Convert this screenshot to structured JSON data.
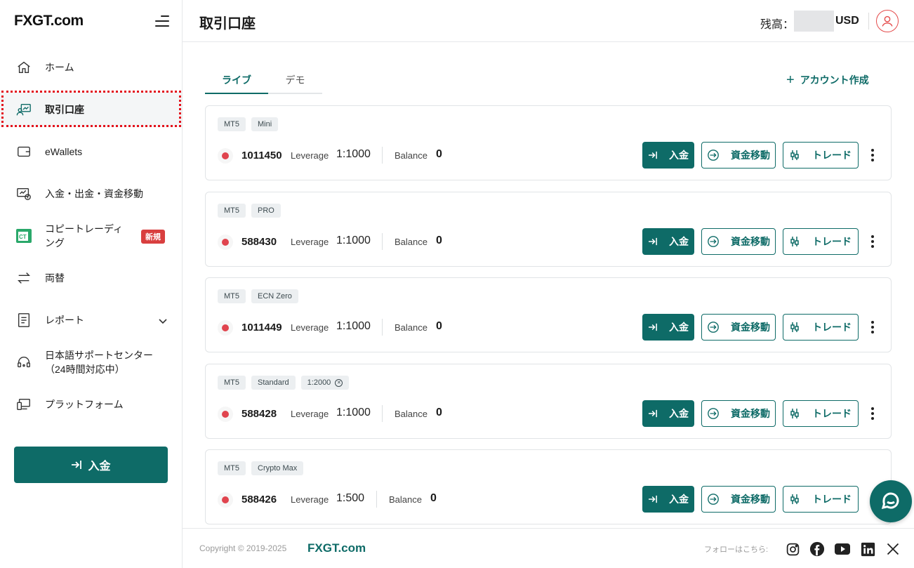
{
  "brand": {
    "logo_main": "FXGT",
    "logo_suffix": ".com"
  },
  "sidebar": {
    "items": [
      {
        "label": "ホーム",
        "icon": "home-icon"
      },
      {
        "label": "取引口座",
        "icon": "trading-accounts-icon",
        "active": true
      },
      {
        "label": "eWallets",
        "icon": "wallet-icon"
      },
      {
        "label": "入金・出金・資金移動",
        "icon": "deposit-withdraw-icon"
      },
      {
        "label": "コピートレーディング",
        "icon": "copy-trading-icon",
        "badge": "新規"
      },
      {
        "label": "両替",
        "icon": "exchange-icon"
      },
      {
        "label": "レポート",
        "icon": "report-icon"
      },
      {
        "label": "日本語サポートセンター（24時間対応中）",
        "icon": "support-headset-icon"
      },
      {
        "label": "プラットフォーム",
        "icon": "platform-icon"
      }
    ],
    "deposit_button": "入金"
  },
  "header": {
    "title": "取引口座",
    "balance_label": "残高：",
    "currency": "USD"
  },
  "tabs": [
    {
      "label": "ライブ",
      "active": true
    },
    {
      "label": "デモ",
      "active": false
    }
  ],
  "add_account_label": "アカウント作成",
  "accounts": [
    {
      "tags": [
        "MT5",
        "Mini"
      ],
      "number": "1011450",
      "leverage_label": "Leverage",
      "leverage": "1:1000",
      "balance_label": "Balance",
      "balance": "0"
    },
    {
      "tags": [
        "MT5",
        "PRO"
      ],
      "number": "588430",
      "leverage_label": "Leverage",
      "leverage": "1:1000",
      "balance_label": "Balance",
      "balance": "0"
    },
    {
      "tags": [
        "MT5",
        "ECN Zero"
      ],
      "number": "1011449",
      "leverage_label": "Leverage",
      "leverage": "1:1000",
      "balance_label": "Balance",
      "balance": "0"
    },
    {
      "tags": [
        "MT5",
        "Standard",
        "1:2000"
      ],
      "number": "588428",
      "leverage_label": "Leverage",
      "leverage": "1:1000",
      "balance_label": "Balance",
      "balance": "0"
    },
    {
      "tags": [
        "MT5",
        "Crypto Max"
      ],
      "number": "588426",
      "leverage_label": "Leverage",
      "leverage": "1:500",
      "balance_label": "Balance",
      "balance": "0"
    }
  ],
  "account_actions": {
    "deposit": "入金",
    "transfer": "資金移動",
    "trade": "トレード"
  },
  "footer": {
    "copyright": "Copyright © 2019-2025",
    "brand": "FXGT.com",
    "follow": "フォローはこちら:",
    "socials": [
      "instagram-icon",
      "facebook-icon",
      "youtube-icon",
      "linkedin-icon",
      "x-icon"
    ]
  },
  "colors": {
    "primary": "#0e6b67",
    "status_red": "#e0444e",
    "badge_red": "#d93f3f"
  }
}
